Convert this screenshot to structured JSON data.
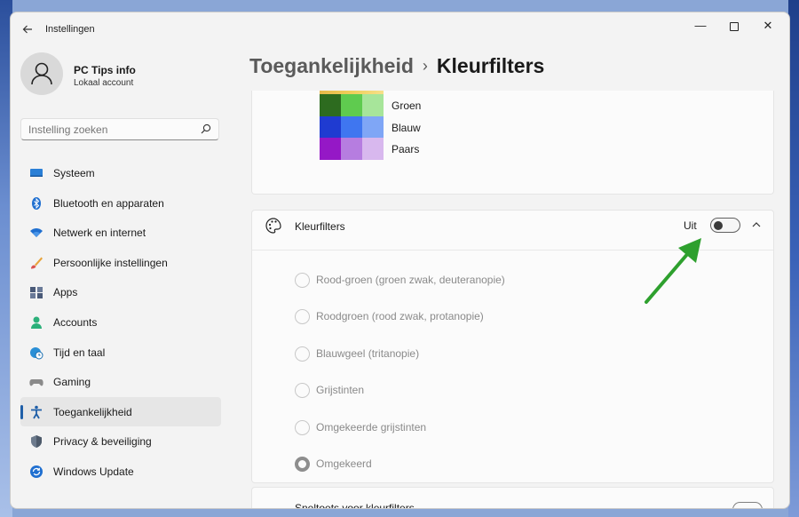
{
  "app": {
    "title": "Instellingen"
  },
  "window_controls": {
    "minimize": "—",
    "close": "✕"
  },
  "user": {
    "name": "PC Tips info",
    "account": "Lokaal account"
  },
  "search": {
    "placeholder": "Instelling zoeken"
  },
  "sidebar": {
    "items": [
      {
        "label": "Systeem",
        "icon": "monitor-icon",
        "active": false
      },
      {
        "label": "Bluetooth en apparaten",
        "icon": "bluetooth-icon",
        "active": false
      },
      {
        "label": "Netwerk en internet",
        "icon": "wifi-icon",
        "active": false
      },
      {
        "label": "Persoonlijke instellingen",
        "icon": "brush-icon",
        "active": false
      },
      {
        "label": "Apps",
        "icon": "apps-icon",
        "active": false
      },
      {
        "label": "Accounts",
        "icon": "person-icon",
        "active": false
      },
      {
        "label": "Tijd en taal",
        "icon": "globe-clock-icon",
        "active": false
      },
      {
        "label": "Gaming",
        "icon": "gamepad-icon",
        "active": false
      },
      {
        "label": "Toegankelijkheid",
        "icon": "accessibility-icon",
        "active": true
      },
      {
        "label": "Privacy & beveiliging",
        "icon": "shield-icon",
        "active": false
      },
      {
        "label": "Windows Update",
        "icon": "update-icon",
        "active": false
      }
    ]
  },
  "breadcrumb": {
    "parent": "Toegankelijkheid",
    "separator": "›",
    "current": "Kleurfilters"
  },
  "preview": {
    "rows": [
      {
        "label": "Groen",
        "colors": [
          "#2d6b1f",
          "#5fcb4f",
          "#a7e59a"
        ]
      },
      {
        "label": "Blauw",
        "colors": [
          "#1f3bd1",
          "#3f76f0",
          "#7fa6f6"
        ]
      },
      {
        "label": "Paars",
        "colors": [
          "#9518c6",
          "#b67de0",
          "#d8b8ee"
        ]
      }
    ]
  },
  "color_filters": {
    "title": "Kleurfilters",
    "toggle_state": "Uit",
    "toggle_on": false,
    "options": [
      {
        "label": "Rood-groen (groen zwak, deuteranopie)",
        "selected": false
      },
      {
        "label": "Roodgroen (rood zwak, protanopie)",
        "selected": false
      },
      {
        "label": "Blauwgeel (tritanopie)",
        "selected": false
      },
      {
        "label": "Grijstinten",
        "selected": false
      },
      {
        "label": "Omgekeerde grijstinten",
        "selected": false
      },
      {
        "label": "Omgekeerd",
        "selected": true
      }
    ]
  },
  "shortcut": {
    "title": "Sneltoets voor kleurfilters"
  },
  "colors": {
    "accent": "#1f5fa8",
    "arrow": "#2ea02e"
  }
}
